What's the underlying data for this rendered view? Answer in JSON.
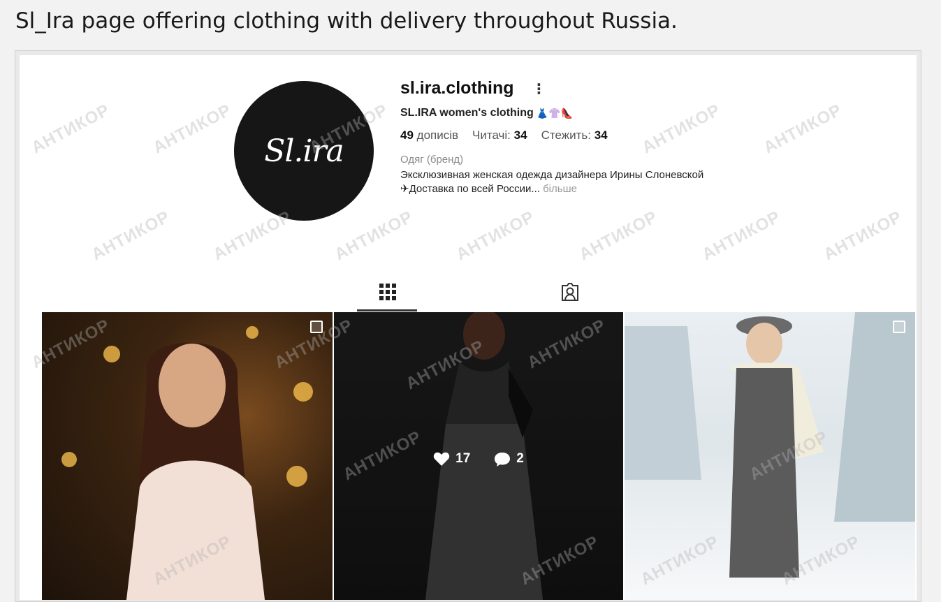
{
  "caption": "Sl_Ira page offering clothing with delivery throughout Russia.",
  "profile": {
    "username": "sl.ira.clothing",
    "full_name": "SL.IRA women's clothing",
    "full_name_emojis": "👗👚👠",
    "stats": {
      "posts_value": "49",
      "posts_label": "дописів",
      "followers_label": "Читачі:",
      "followers_value": "34",
      "following_label": "Стежить:",
      "following_value": "34"
    },
    "category": "Одяг (бренд)",
    "bio_line1": "Эксклюзивная женская одежда дизайнера Ирины Слоневской",
    "bio_line2": "✈Доставка по всей России...",
    "more_label": "більше",
    "logo_text": "Sl.ira"
  },
  "tabs": {
    "grid_icon": "grid-icon",
    "tagged_icon": "tagged-icon"
  },
  "posts": [
    {
      "multi": true
    },
    {
      "likes": "17",
      "comments": "2"
    },
    {
      "multi": true
    }
  ],
  "watermark_text": "АНТИКОР",
  "colors": {
    "background": "#f2f2f2",
    "panel": "#ffffff",
    "text": "#111111",
    "muted": "#8a8a8a"
  }
}
